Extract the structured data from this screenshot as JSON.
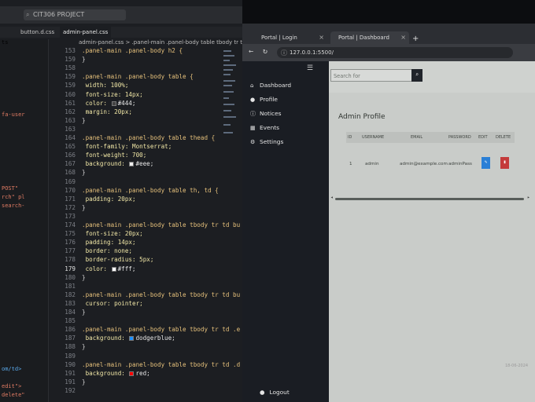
{
  "editor": {
    "search_text": "CIT306 PROJECT",
    "tabs": [
      "button.d.css",
      "admin-panel.css"
    ],
    "breadcrumb": "admin-panel.css > .panel-main .panel-body table tbody tr td button",
    "explorer_snippets": [
      {
        "text": "ts",
        "color": "#c7c7c7"
      },
      {
        "text": "fa-user",
        "color": "#e07b63"
      },
      {
        "text": "POST\"",
        "color": "#e07b63"
      },
      {
        "text": "rch\" pl",
        "color": "#e07b63"
      },
      {
        "text": "search-",
        "color": "#e07b63"
      },
      {
        "text": "om/td>",
        "color": "#5aa8e8"
      },
      {
        "text": "edit\">",
        "color": "#e07b63"
      },
      {
        "text": "delete\"",
        "color": "#e07b63"
      }
    ],
    "lines": [
      {
        "n": "153",
        "t": ".panel-main .panel-body h2 {",
        "k": "sel"
      },
      {
        "n": "159",
        "t": "}",
        "k": "punc"
      },
      {
        "n": "158",
        "t": "",
        "k": "punc"
      },
      {
        "n": "159",
        "t": ".panel-main .panel-body table {",
        "k": "sel"
      },
      {
        "n": "159",
        "t": "    width: 100%;",
        "k": "prop"
      },
      {
        "n": "160",
        "t": "    font-size: 14px;",
        "k": "prop"
      },
      {
        "n": "161",
        "t": "    color: ",
        "k": "prop",
        "swatch": "#444444",
        "tail": "#444;"
      },
      {
        "n": "162",
        "t": "    margin: 20px;",
        "k": "prop"
      },
      {
        "n": "163",
        "t": "}",
        "k": "punc"
      },
      {
        "n": "163",
        "t": "",
        "k": "punc"
      },
      {
        "n": "164",
        "t": ".panel-main .panel-body table thead {",
        "k": "sel"
      },
      {
        "n": "165",
        "t": "    font-family: Montserrat;",
        "k": "prop"
      },
      {
        "n": "166",
        "t": "    font-weight: 700;",
        "k": "prop"
      },
      {
        "n": "167",
        "t": "    background: ",
        "k": "prop",
        "swatch": "#eeeeee",
        "tail": "#eee;"
      },
      {
        "n": "168",
        "t": "}",
        "k": "punc"
      },
      {
        "n": "169",
        "t": "",
        "k": "punc"
      },
      {
        "n": "170",
        "t": ".panel-main .panel-body table th, td {",
        "k": "sel"
      },
      {
        "n": "171",
        "t": "    padding: 20px;",
        "k": "prop"
      },
      {
        "n": "172",
        "t": "}",
        "k": "punc"
      },
      {
        "n": "173",
        "t": "",
        "k": "punc"
      },
      {
        "n": "174",
        "t": ".panel-main .panel-body table tbody tr td bu",
        "k": "sel"
      },
      {
        "n": "175",
        "t": "    font-size: 20px;",
        "k": "prop"
      },
      {
        "n": "176",
        "t": "    padding: 14px;",
        "k": "prop"
      },
      {
        "n": "177",
        "t": "    border: none;",
        "k": "prop"
      },
      {
        "n": "178",
        "t": "    border-radius: 5px;",
        "k": "prop"
      },
      {
        "n": "179",
        "t": "    color: ",
        "k": "prop",
        "swatch": "#ffffff",
        "tail": "#fff;"
      },
      {
        "n": "180",
        "t": "}",
        "k": "punc"
      },
      {
        "n": "181",
        "t": "",
        "k": "punc"
      },
      {
        "n": "182",
        "t": ".panel-main .panel-body table tbody tr td bu",
        "k": "sel"
      },
      {
        "n": "183",
        "t": "    cursor: pointer;",
        "k": "prop"
      },
      {
        "n": "184",
        "t": "}",
        "k": "punc"
      },
      {
        "n": "185",
        "t": "",
        "k": "punc"
      },
      {
        "n": "186",
        "t": ".panel-main .panel-body table tbody tr td .e",
        "k": "sel"
      },
      {
        "n": "187",
        "t": "    background: ",
        "k": "prop",
        "swatch": "#1e90ff",
        "tail": "dodgerblue;"
      },
      {
        "n": "188",
        "t": "}",
        "k": "punc"
      },
      {
        "n": "189",
        "t": "",
        "k": "punc"
      },
      {
        "n": "190",
        "t": ".panel-main .panel-body table tbody tr td .d",
        "k": "sel"
      },
      {
        "n": "191",
        "t": "    background: ",
        "k": "prop",
        "swatch": "#ff0000",
        "tail": "red;"
      },
      {
        "n": "191",
        "t": "}",
        "k": "punc"
      },
      {
        "n": "192",
        "t": "",
        "k": "punc"
      }
    ],
    "current_line": "179"
  },
  "browser": {
    "tabs": [
      "Portal | Login",
      "Portal | Dashboard"
    ],
    "new_tab": "+",
    "url": "127.0.0.1:5500/"
  },
  "page": {
    "nav": [
      {
        "label": "Dashboard",
        "icon": "home-icon",
        "glyph": "⌂"
      },
      {
        "label": "Profile",
        "icon": "user-icon",
        "glyph": "●"
      },
      {
        "label": "Notices",
        "icon": "info-icon",
        "glyph": "ⓘ"
      },
      {
        "label": "Events",
        "icon": "calendar-icon",
        "glyph": "▦"
      },
      {
        "label": "Settings",
        "icon": "gear-icon",
        "glyph": "⚙"
      }
    ],
    "logout": "Logout",
    "search_placeholder": "Search for",
    "profile_title": "Admin Profile",
    "columns": [
      "ID",
      "USERNAME",
      "EMAIL",
      "PASSWORD",
      "EDIT",
      "DELETE"
    ],
    "row": [
      "1",
      "admin",
      "admin@example.com",
      "adminPass"
    ]
  },
  "taskbar": {
    "clock": "18-06-2024"
  },
  "colors": {
    "edit": "#2a7fd6",
    "delete": "#c43b3b",
    "sidebar": "#1a1d23"
  }
}
